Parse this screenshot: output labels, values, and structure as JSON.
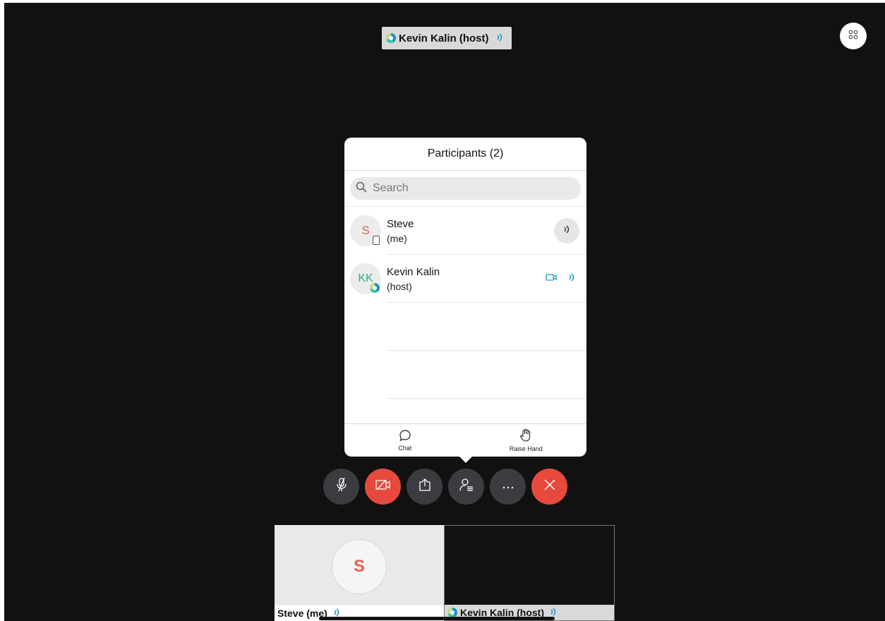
{
  "active_speaker": {
    "name": "Kevin Kalin (host)"
  },
  "participants_panel": {
    "title": "Participants (2)",
    "search_placeholder": "Search",
    "participants": [
      {
        "initials": "S",
        "name": "Steve",
        "role": "(me)",
        "device": "phone-icon",
        "initials_color": "#e8604c"
      },
      {
        "initials": "KK",
        "name": "Kevin Kalin",
        "role": "(host)",
        "device": "webex-app-icon",
        "initials_color": "#2eaa8e"
      }
    ],
    "footer": {
      "chat_label": "Chat",
      "raise_hand_label": "Raise Hand"
    }
  },
  "controls": [
    {
      "name": "mute-button",
      "icon": "mic-off-icon"
    },
    {
      "name": "stop-video-button",
      "icon": "video-off-icon"
    },
    {
      "name": "share-button",
      "icon": "share-icon"
    },
    {
      "name": "participants-button",
      "icon": "participants-icon"
    },
    {
      "name": "more-button",
      "icon": "more-icon"
    },
    {
      "name": "leave-button",
      "icon": "close-icon"
    }
  ],
  "thumbnails": [
    {
      "initials": "S",
      "label": "Steve (me)"
    },
    {
      "label": "Kevin Kalin (host)"
    }
  ],
  "colors": {
    "accent_blue": "#1a9cd8",
    "danger_red": "#e8493d",
    "background": "#111111",
    "control_gray": "#3a3c3f"
  }
}
